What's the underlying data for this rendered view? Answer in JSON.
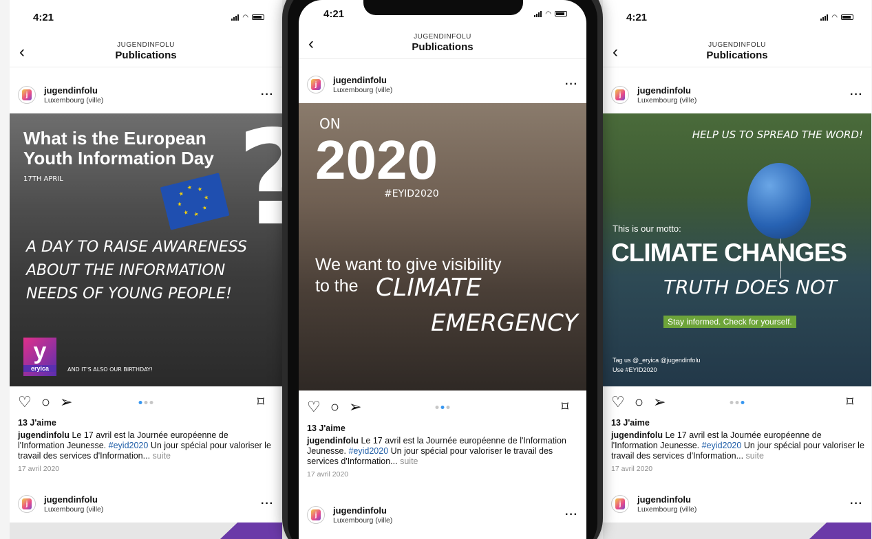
{
  "screens": [
    {
      "time": "4:21",
      "nav": {
        "subtitle": "JUGENDINFOLU",
        "title": "Publications"
      },
      "post": {
        "username": "jugendinfolu",
        "location": "Luxembourg (ville)"
      },
      "image": {
        "title_line1": "What is the European",
        "title_line2": "Youth Information Day",
        "date": "17TH APRIL",
        "body_line1": "A DAY TO RAISE AWARENESS",
        "body_line2": "ABOUT THE INFORMATION",
        "body_line3": "NEEDS OF YOUNG PEOPLE!",
        "footer": "AND IT'S ALSO OUR BIRTHDAY!",
        "logo_text": "eryica"
      },
      "likes": "13 J'aime",
      "caption": {
        "username": "jugendinfolu",
        "text1": "Le 17 avril est la Journée européenne de l'Information Jeunesse.",
        "hashtag": "#eyid2020",
        "text2": "Un jour spécial pour valoriser le travail des services d'Information...",
        "more": "suite"
      },
      "date": "17 avril 2020",
      "next_post": {
        "username": "jugendinfolu",
        "location": "Luxembourg (ville)"
      }
    },
    {
      "time": "4:21",
      "nav": {
        "subtitle": "JUGENDINFOLU",
        "title": "Publications"
      },
      "post": {
        "username": "jugendinfolu",
        "location": "Luxembourg (ville)"
      },
      "image": {
        "on": "ON",
        "year": "2020",
        "tag": "#EYID2020",
        "line1": "We want to give visibility",
        "line2": "to the",
        "climate": "CLIMATE",
        "emergency": "EMERGENCY"
      },
      "likes": "13 J'aime",
      "caption": {
        "username": "jugendinfolu",
        "text1": "Le 17 avril est la Journée européenne de l'Information Jeunesse.",
        "hashtag": "#eyid2020",
        "text2": "Un jour spécial pour valoriser le travail des services d'Information...",
        "more": "suite"
      },
      "date": "17 avril 2020",
      "next_post": {
        "username": "jugendinfolu",
        "location": "Luxembourg (ville)"
      }
    },
    {
      "time": "4:21",
      "nav": {
        "subtitle": "JUGENDINFOLU",
        "title": "Publications"
      },
      "post": {
        "username": "jugendinfolu",
        "location": "Luxembourg (ville)"
      },
      "image": {
        "top": "HELP US TO SPREAD THE WORD!",
        "motto": "This is our motto:",
        "big": "CLIMATE CHANGES",
        "truth": "TRUTH DOES NOT",
        "banner": "Stay informed. Check for yourself.",
        "tag1": "Tag us @_eryica  @jugendinfolu",
        "tag2": "Use #EYID2020"
      },
      "likes": "13 J'aime",
      "caption": {
        "username": "jugendinfolu",
        "text1": "Le 17 avril est la Journée européenne de l'Information Jeunesse.",
        "hashtag": "#eyid2020",
        "text2": "Un jour spécial pour valoriser le travail des services d'Information...",
        "more": "suite"
      },
      "date": "17 avril 2020",
      "next_post": {
        "username": "jugendinfolu",
        "location": "Luxembourg (ville)"
      }
    }
  ],
  "avatar_glyph": "j",
  "icons": {
    "back": "chevron-left-icon",
    "like": "heart-icon",
    "comment": "comment-icon",
    "share": "send-icon",
    "save": "bookmark-icon",
    "more": "more-icon"
  },
  "colors": {
    "link": "#1f5ea8",
    "dot_active": "#3897f0",
    "purple": "#6b3aa8",
    "green_banner": "#6da43a"
  }
}
